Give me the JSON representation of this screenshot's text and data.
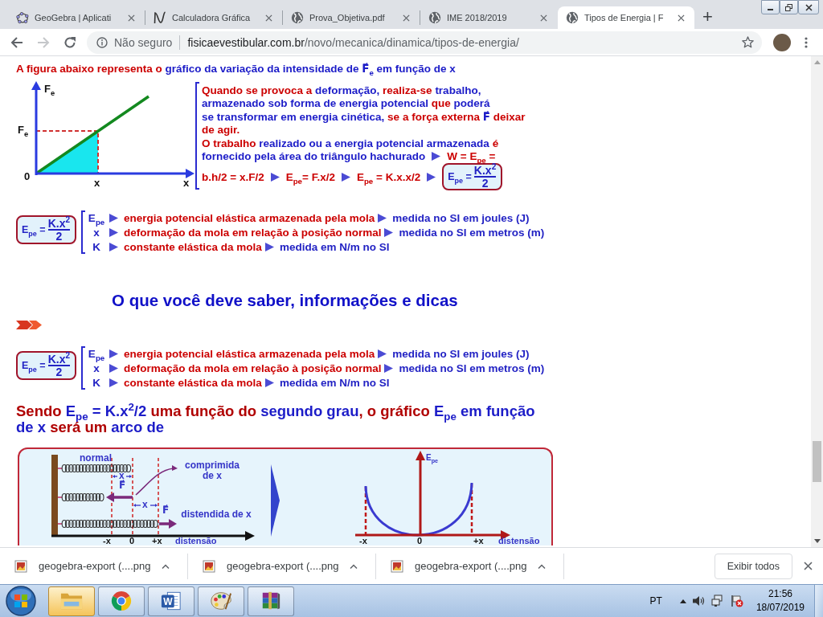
{
  "tabs": [
    {
      "kind": "geogebra",
      "title": "GeoGebra | Aplicati",
      "selected": false
    },
    {
      "kind": "graph",
      "title": "Calculadora Gráfica",
      "selected": false
    },
    {
      "kind": "globe",
      "title": "Prova_Objetiva.pdf",
      "selected": false
    },
    {
      "kind": "globe",
      "title": "IME 2018/2019",
      "selected": false
    },
    {
      "kind": "globe",
      "title": "Tipos de Energia | F",
      "selected": true
    }
  ],
  "new_tab": "+",
  "navigation": {
    "back_disabled": false,
    "forward_disabled": true
  },
  "address_bar": {
    "security": "Não seguro",
    "domain": "fisicaevestibular.com.br",
    "path": "/novo/mecanica/dinamica/tipos-de-energia/"
  },
  "page": {
    "intro": [
      {
        "text": "A figura abaixo representa o ",
        "color": "#cc0000"
      },
      {
        "text": "gráfico da variação da intensidade de F⃗$_{e}$ em função de x",
        "color": "#1c1cc8"
      }
    ],
    "force_graph": {
      "y_axis": "F$_{e}$",
      "level": "F$_{e}$",
      "origin": "0",
      "point": "x",
      "x_axis": "x"
    },
    "explanation": [
      {
        "chunks": [
          {
            "kind": "text",
            "runs": [
              {
                "text": "Quando se provoca a ",
                "color": "#cc0000"
              },
              {
                "text": "deformação, ",
                "color": "#1c1cc8"
              },
              {
                "text": "realiza-se ",
                "color": "#cc0000"
              },
              {
                "text": "trabalho,",
                "color": "#1c1cc8"
              }
            ]
          }
        ]
      },
      {
        "chunks": [
          {
            "kind": "text",
            "runs": [
              {
                "text": "armazenado sob forma de energia potencial ",
                "color": "#1c1cc8"
              },
              {
                "text": "que ",
                "color": "#cc0000"
              },
              {
                "text": "poderá",
                "color": "#1c1cc8"
              }
            ]
          }
        ]
      },
      {
        "chunks": [
          {
            "kind": "text",
            "runs": [
              {
                "text": "se transformar em energia cinética, ",
                "color": "#1c1cc8"
              },
              {
                "text": "se a força externa ",
                "color": "#cc0000"
              },
              {
                "text": "F⃗ ",
                "color": "#1c1cc8"
              },
              {
                "text": "deixar",
                "color": "#cc0000"
              }
            ]
          }
        ]
      },
      {
        "chunks": [
          {
            "kind": "text",
            "runs": [
              {
                "text": "de agir.",
                "color": "#cc0000"
              }
            ]
          }
        ]
      },
      {
        "chunks": [
          {
            "kind": "text",
            "runs": [
              {
                "text": "O trabalho ",
                "color": "#cc0000"
              },
              {
                "text": "realizado ou a energia potencial armazenada ",
                "color": "#1c1cc8"
              },
              {
                "text": "é",
                "color": "#cc0000"
              }
            ]
          }
        ]
      },
      {
        "chunks": [
          {
            "kind": "text",
            "runs": [
              {
                "text": "fornecido pela área do triângulo hachurado",
                "color": "#1c1cc8"
              }
            ]
          },
          {
            "kind": "arrow"
          },
          {
            "kind": "text",
            "runs": [
              {
                "text": "W = E$_{pe}$ =",
                "color": "#cc0000"
              }
            ]
          }
        ]
      },
      {
        "chunks": [
          {
            "kind": "text",
            "runs": [
              {
                "text": "b.h/2 = x.F/2",
                "color": "#cc0000"
              }
            ]
          },
          {
            "kind": "arrow"
          },
          {
            "kind": "text",
            "runs": [
              {
                "text": "E$_{pe}$= F.x/2",
                "color": "#cc0000"
              }
            ]
          },
          {
            "kind": "arrow"
          },
          {
            "kind": "text",
            "runs": [
              {
                "text": "E$_{pe}$ = K.x.x/2",
                "color": "#cc0000"
              }
            ]
          },
          {
            "kind": "arrow"
          },
          {
            "kind": "formula",
            "lhs": "E$_{pe}$ =",
            "numerator": "K.x$^{2}$",
            "denominator": "2"
          }
        ]
      }
    ],
    "legend_top": {
      "formula": {
        "lhs": "E$_{pe}$ =",
        "numerator": "K.x$^{2}$",
        "denominator": "2"
      },
      "rows": [
        {
          "symbol": "E$_{pe}$",
          "meaning": "energia potencial elástica armazenada pela mola",
          "unit": "medida no SI em joules (J)"
        },
        {
          "symbol": "x",
          "meaning": "deformação da mola em relação à posição normal",
          "unit": "medida no SI em metros (m)"
        },
        {
          "symbol": "K",
          "meaning": "constante elástica da mola",
          "unit": "medida em N/m no SI"
        }
      ]
    },
    "heading": "O que você deve saber, informações e dicas",
    "legend_bottom": {
      "formula": {
        "lhs": "E$_{pe}$ =",
        "numerator": "K.x$^{2}$",
        "denominator": "2"
      },
      "rows": [
        {
          "symbol": "E$_{pe}$",
          "meaning": "energia potencial elástica armazenada pela mola",
          "unit": "medida no SI em joules (J)"
        },
        {
          "symbol": "x",
          "meaning": "deformação da mola em relação à posição normal",
          "unit": "medida no SI em metros (m)"
        },
        {
          "symbol": "K",
          "meaning": "constante elástica da mola",
          "unit": "medida em N/m no SI"
        }
      ]
    },
    "conclusion": [
      {
        "text": "Sendo ",
        "color": "#b00000"
      },
      {
        "text": "E$_{pe}$ = K.x$^{2}$/2 ",
        "color": "#1c1cc8"
      },
      {
        "text": "uma função do ",
        "color": "#b00000"
      },
      {
        "text": "segundo grau",
        "color": "#1c1cc8"
      },
      {
        "text": ", o gráfico ",
        "color": "#b00000"
      },
      {
        "text": "E$_{pe}$ em função de x ",
        "color": "#1c1cc8"
      },
      {
        "text": "será um ",
        "color": "#b00000"
      },
      {
        "text": "arco de",
        "color": "#1c1cc8"
      }
    ],
    "figure": {
      "springs": {
        "normal": "normal",
        "compressed": "comprimida de x",
        "stretched": "distendida de x",
        "gaps": [
          "x",
          "x"
        ],
        "forces": [
          "F⃗",
          "F⃗"
        ],
        "ticks": [
          "-x",
          "0",
          "+x"
        ],
        "direction": "distensão"
      },
      "energy_graph": {
        "axis": "E$_{pe}$",
        "ticks": [
          "-x",
          "0",
          "+x"
        ],
        "direction": "distensão"
      }
    }
  },
  "downloads": {
    "items": [
      {
        "name": "geogebra-export (....png"
      },
      {
        "name": "geogebra-export (....png"
      },
      {
        "name": "geogebra-export (....png"
      }
    ],
    "show_all": "Exibir todos"
  },
  "taskbar": {
    "apps": [
      {
        "kind": "folder",
        "highlighted": true
      },
      {
        "kind": "browser",
        "highlighted": false
      },
      {
        "kind": "letter",
        "label": "W",
        "highlighted": false
      },
      {
        "kind": "palette",
        "highlighted": false
      },
      {
        "kind": "books",
        "highlighted": false
      }
    ],
    "language": "PT",
    "time": "21:56",
    "date": "18/07/2019"
  }
}
